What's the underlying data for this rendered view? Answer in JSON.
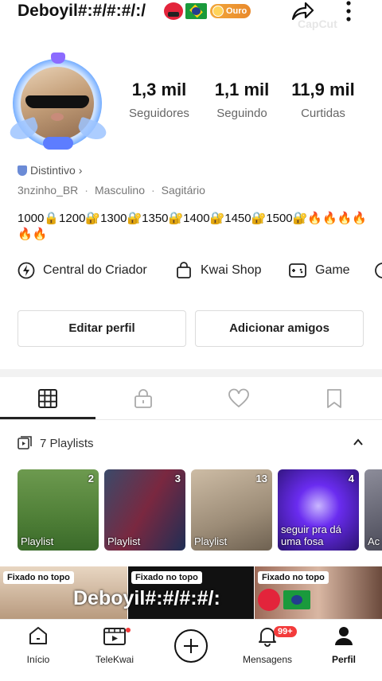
{
  "header": {
    "username": "Deboyil#:#/#:#/:/",
    "badge_label": "Ouro",
    "watermark": "CapCut",
    "icons": [
      "angry-face-icon",
      "brazil-flag-icon",
      "share-icon",
      "more-icon"
    ]
  },
  "stats": [
    {
      "value": "1,3 mil",
      "label": "Seguidores"
    },
    {
      "value": "1,1 mil",
      "label": "Seguindo"
    },
    {
      "value": "11,9 mil",
      "label": "Curtidas"
    }
  ],
  "profile": {
    "distintivo": "Distintivo",
    "handle": "3nzinho_BR",
    "gender": "Masculino",
    "sign": "Sagitário",
    "bio": "1000🔒1200🔐1300🔐1350🔐1400🔐1450🔐1500🔐🔥🔥🔥🔥🔥🔥"
  },
  "quick_links": [
    {
      "label": "Central do Criador",
      "icon": "bolt-icon"
    },
    {
      "label": "Kwai Shop",
      "icon": "bag-icon"
    },
    {
      "label": "Game",
      "icon": "gamepad-icon"
    }
  ],
  "actions": {
    "edit": "Editar perfil",
    "add_friends": "Adicionar amigos"
  },
  "tabs": [
    "grid-icon",
    "lock-icon",
    "heart-icon",
    "bookmark-icon"
  ],
  "playlists": {
    "header": "7 Playlists",
    "items": [
      {
        "count": "2",
        "title": "Playlist"
      },
      {
        "count": "3",
        "title": "Playlist"
      },
      {
        "count": "13",
        "title": "Playlist"
      },
      {
        "count": "4",
        "title": "seguir pra dá uma fosa"
      },
      {
        "count": "",
        "title": "Ac rev"
      }
    ]
  },
  "pinned": {
    "label": "Fixado no topo",
    "overlay_name": "Deboyil#:#/#:#/:"
  },
  "bottom_nav": [
    {
      "label": "Início",
      "icon": "home-icon"
    },
    {
      "label": "TeleKwai",
      "icon": "tv-icon"
    },
    {
      "label": "",
      "icon": "plus-icon"
    },
    {
      "label": "Mensagens",
      "icon": "bell-icon",
      "badge": "99+"
    },
    {
      "label": "Perfil",
      "icon": "person-icon"
    }
  ],
  "colors": {
    "accent_red": "#f33b3b",
    "gold_badge": "#f2a73a",
    "distintivo_blue": "#6b8bd6"
  }
}
